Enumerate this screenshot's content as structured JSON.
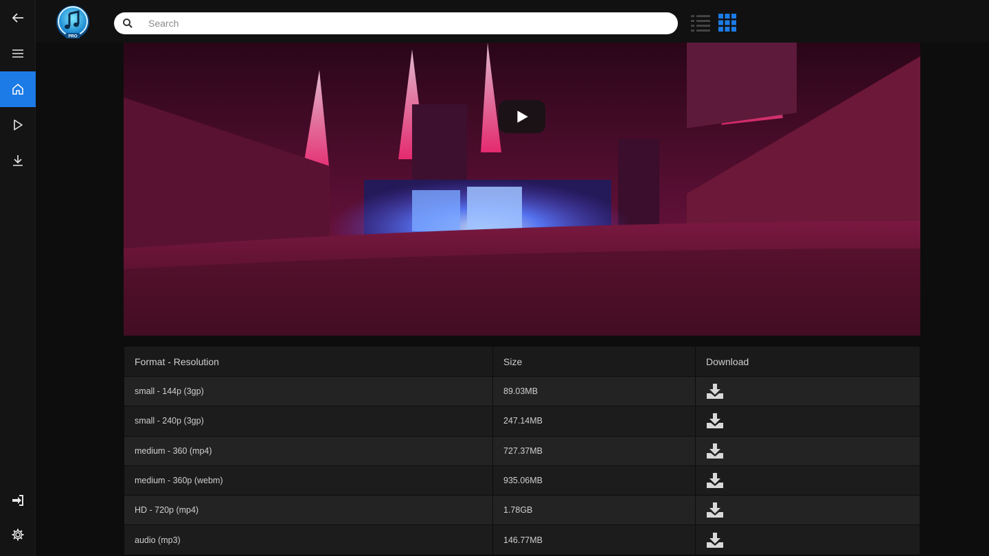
{
  "search": {
    "placeholder": "Search"
  },
  "colors": {
    "accent": "#1c7be6",
    "sidebar": "#141414",
    "table_row": "#232323"
  },
  "sidebar": {
    "items": [
      {
        "name": "back",
        "icon": "arrow-left-icon"
      },
      {
        "name": "menu",
        "icon": "hamburger-icon"
      },
      {
        "name": "home",
        "icon": "home-icon",
        "active": true
      },
      {
        "name": "play",
        "icon": "play-icon"
      },
      {
        "name": "downloads",
        "icon": "download-icon"
      },
      {
        "name": "login",
        "icon": "sign-in-icon"
      },
      {
        "name": "settings",
        "icon": "gear-icon"
      }
    ]
  },
  "logo": {
    "badge_text": "PRO",
    "icon": "music-note-icon"
  },
  "view_toggle": {
    "list_icon": "list-view-icon",
    "grid_icon": "grid-view-icon",
    "selected": "grid"
  },
  "video": {
    "play_icon": "play-icon"
  },
  "table": {
    "headers": [
      "Format - Resolution",
      "Size",
      "Download"
    ],
    "rows": [
      {
        "format": "small - 144p (3gp)",
        "size": "89.03MB"
      },
      {
        "format": "small - 240p (3gp)",
        "size": "247.14MB"
      },
      {
        "format": "medium - 360 (mp4)",
        "size": "727.37MB"
      },
      {
        "format": "medium - 360p (webm)",
        "size": "935.06MB"
      },
      {
        "format": "HD - 720p (mp4)",
        "size": "1.78GB"
      },
      {
        "format": "audio (mp3)",
        "size": "146.77MB"
      }
    ]
  }
}
